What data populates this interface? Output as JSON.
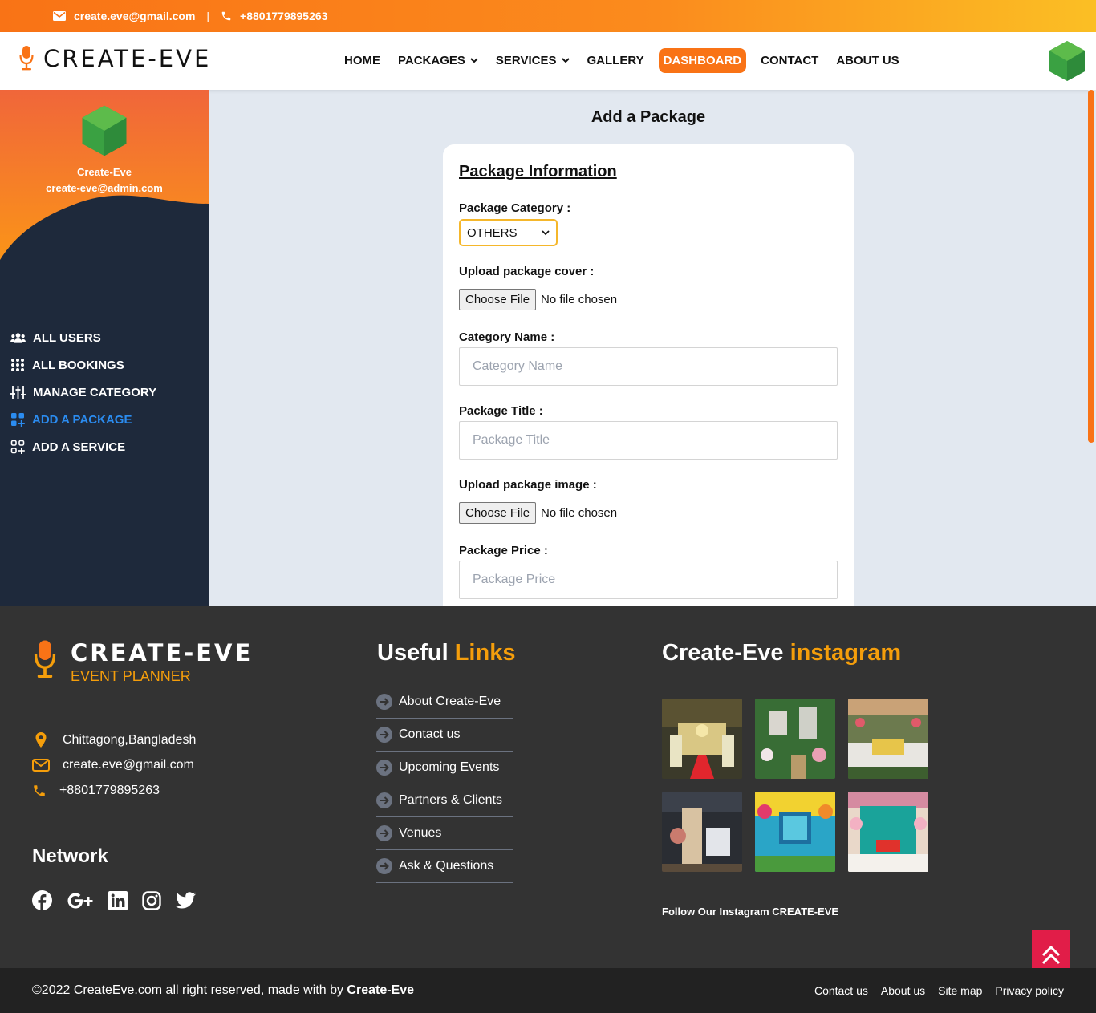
{
  "topbar": {
    "email": "create.eve@gmail.com",
    "separator": "|",
    "phone": "+8801779895263"
  },
  "brand": {
    "name": "CREATE-EVE",
    "tagline": "EVENT PLANNER"
  },
  "nav": {
    "items": [
      {
        "label": "HOME",
        "dropdown": false
      },
      {
        "label": "PACKAGES",
        "dropdown": true
      },
      {
        "label": "SERVICES",
        "dropdown": true
      },
      {
        "label": "GALLERY",
        "dropdown": false
      },
      {
        "label": "DASHBOARD",
        "dropdown": false,
        "active": true
      },
      {
        "label": "CONTACT",
        "dropdown": false
      },
      {
        "label": "ABOUT US",
        "dropdown": false
      }
    ]
  },
  "sidebar": {
    "user_name": "Create-Eve",
    "user_email": "create-eve@admin.com",
    "items": [
      {
        "label": "ALL USERS",
        "icon": "users-icon"
      },
      {
        "label": "ALL BOOKINGS",
        "icon": "grid-dots-icon"
      },
      {
        "label": "MANAGE CATEGORY",
        "icon": "sliders-icon"
      },
      {
        "label": "ADD A PACKAGE",
        "icon": "add-grid-icon",
        "active": true
      },
      {
        "label": "ADD A SERVICE",
        "icon": "add-grid-outline-icon"
      }
    ]
  },
  "main": {
    "title": "Add a Package",
    "section_heading": "Package Information",
    "category_label": "Package Category :",
    "category_value": "OTHERS",
    "cover_label": "Upload package cover :",
    "file_button": "Choose File",
    "file_status": "No file chosen",
    "category_name_label": "Category Name :",
    "category_name_placeholder": "Category Name",
    "title_label": "Package Title :",
    "title_placeholder": "Package Title",
    "image_label": "Upload package image :",
    "price_label": "Package Price :",
    "price_placeholder": "Package Price"
  },
  "footer": {
    "address": "Chittagong,Bangladesh",
    "email": "create.eve@gmail.com",
    "phone": "+8801779895263",
    "network_heading": "Network",
    "social_icons": [
      "facebook-icon",
      "google-plus-icon",
      "linkedin-icon",
      "instagram-icon",
      "twitter-icon"
    ],
    "links_heading_a": "Useful",
    "links_heading_b": "Links",
    "links": [
      "About Create-Eve",
      "Contact us",
      "Upcoming Events",
      "Partners & Clients",
      "Venues",
      "Ask & Questions"
    ],
    "insta_heading_a": "Create-Eve",
    "insta_heading_b": "instagram",
    "follow_text": "Follow Our Instagram CREATE-EVE",
    "copyright_prefix": "©2022 CreateEve.com all right reserved, made with by",
    "copyright_brand": "Create-Eve",
    "bottom_links": [
      "Contact us",
      "About us",
      "Site map",
      "Privacy policy"
    ]
  },
  "colors": {
    "accent": "#f97316",
    "amber": "#f59e0b",
    "sidebar_bg": "#1e293b",
    "active_link": "#2b8cf0",
    "footer_bg": "#333333"
  }
}
